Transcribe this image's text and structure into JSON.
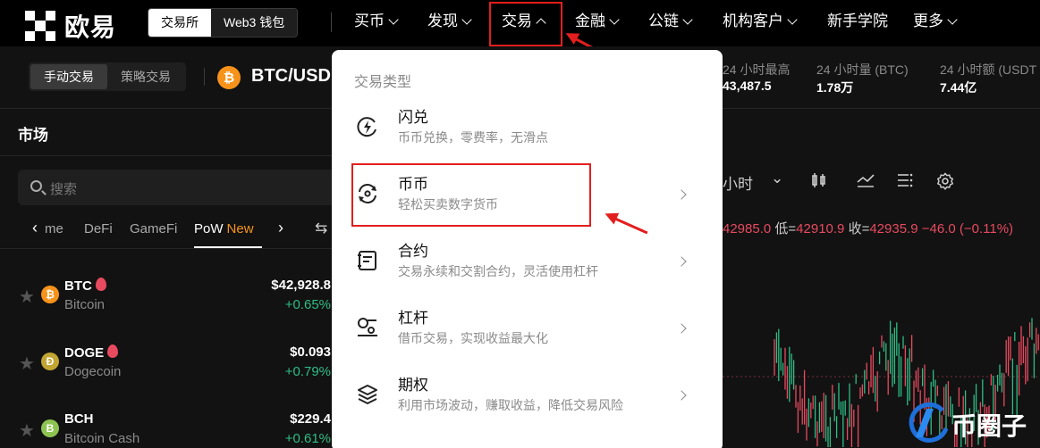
{
  "brand": {
    "name": "欧易"
  },
  "mode_switch": {
    "exchange": "交易所",
    "web3": "Web3 钱包"
  },
  "nav": [
    {
      "label": "买币",
      "chevron": "down"
    },
    {
      "label": "发现",
      "chevron": "down"
    },
    {
      "label": "交易",
      "chevron": "up"
    },
    {
      "label": "金融",
      "chevron": "down"
    },
    {
      "label": "公链",
      "chevron": "down"
    },
    {
      "label": "机构客户",
      "chevron": "down"
    },
    {
      "label": "新手学院",
      "chevron": ""
    },
    {
      "label": "更多",
      "chevron": "down"
    }
  ],
  "trade_mode": {
    "manual": "手动交易",
    "strategy": "策略交易"
  },
  "pair": {
    "symbol": "BTC/USD",
    "icon": "bitcoin-icon"
  },
  "stats": [
    {
      "label": "24 小时最高",
      "value": "43,487.5"
    },
    {
      "label": "24 小时量 (BTC)",
      "value": "1.78万"
    },
    {
      "label": "24 小时额 (USDT",
      "value": "7.44亿"
    }
  ],
  "market": {
    "title": "市场",
    "search_placeholder": "搜索",
    "tabs": [
      "me",
      "DeFi",
      "GameFi",
      "PoW",
      "New"
    ],
    "rows": [
      {
        "symbol": "BTC",
        "name": "Bitcoin",
        "price": "$42,928.8",
        "change": "+0.65%",
        "icon_color": "#f7931a",
        "icon_glyph": "₿"
      },
      {
        "symbol": "DOGE",
        "name": "Dogecoin",
        "price": "$0.093",
        "change": "+0.79%",
        "icon_color": "#c2a633",
        "icon_glyph": "Ð"
      },
      {
        "symbol": "BCH",
        "name": "Bitcoin Cash",
        "price": "$229.4",
        "change": "+0.61%",
        "icon_color": "#8dc351",
        "icon_glyph": "B"
      }
    ]
  },
  "chart_toolbar": {
    "interval": "小时"
  },
  "ohlc": {
    "open_tail": "42985.0",
    "low_label": "低=",
    "low": "42910.9",
    "close_label": "收=",
    "close": "42935.9",
    "change": "−46.0 (−0.11%)"
  },
  "dropdown": {
    "header": "交易类型",
    "items": [
      {
        "title": "闪兑",
        "subtitle": "币币兑换，零费率，无滑点",
        "icon": "flash-swap-icon",
        "chevron": false
      },
      {
        "title": "币币",
        "subtitle": "轻松买卖数字货币",
        "icon": "spot-icon",
        "chevron": true
      },
      {
        "title": "合约",
        "subtitle": "交易永续和交割合约，灵活使用杠杆",
        "icon": "contract-icon",
        "chevron": true
      },
      {
        "title": "杠杆",
        "subtitle": "借币交易，实现收益最大化",
        "icon": "margin-icon",
        "chevron": true
      },
      {
        "title": "期权",
        "subtitle": "利用市场波动，赚取收益，降低交易风险",
        "icon": "options-icon",
        "chevron": true
      }
    ]
  },
  "watermark": {
    "text": "币圈子"
  },
  "colors": {
    "highlight": "#e31e1e",
    "up": "#2ebd85",
    "down": "#e84a5f",
    "btc": "#f7931a"
  }
}
